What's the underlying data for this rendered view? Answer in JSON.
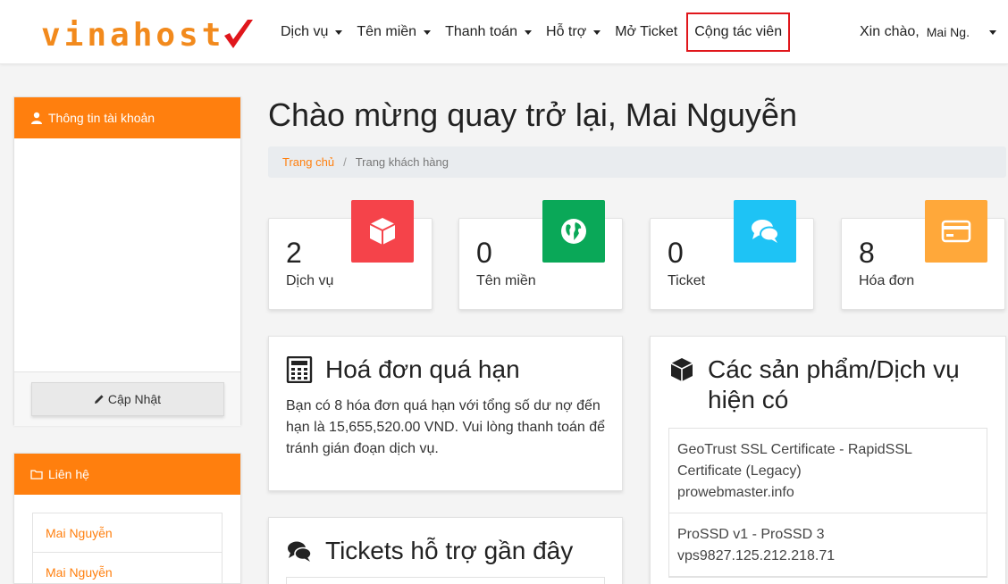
{
  "brand": {
    "name": "vinahost",
    "colors": {
      "primary": "#ff7f0e",
      "logo": "#f28a1d",
      "check": "#e0161b"
    }
  },
  "nav": {
    "items": [
      {
        "label": "Dịch vụ",
        "dropdown": true
      },
      {
        "label": "Tên miền",
        "dropdown": true
      },
      {
        "label": "Thanh toán",
        "dropdown": true
      },
      {
        "label": "Hỗ trợ",
        "dropdown": true
      },
      {
        "label": "Mở Ticket",
        "dropdown": false
      },
      {
        "label": "Cộng tác viên",
        "dropdown": false,
        "highlighted": true
      }
    ],
    "greeting": "Xin chào,",
    "user_short": "Mai Ng."
  },
  "sidebar": {
    "account": {
      "title": "Thông tin tài khoản",
      "icon": "user-icon",
      "update_label": "Cập Nhật"
    },
    "contact": {
      "title": "Liên hệ",
      "icon": "folder-icon",
      "items": [
        "Mai Nguyễn",
        "Mai Nguyễn"
      ]
    }
  },
  "main": {
    "title": "Chào mừng quay trở lại, Mai Nguyễn",
    "breadcrumb": {
      "home": "Trang chủ",
      "separator": "/",
      "current": "Trang khách hàng"
    },
    "stats": [
      {
        "value": "2",
        "label": "Dịch vụ",
        "icon": "cube-icon",
        "color": "#f5434a"
      },
      {
        "value": "0",
        "label": "Tên miền",
        "icon": "globe-icon",
        "color": "#0aa858"
      },
      {
        "value": "0",
        "label": "Ticket",
        "icon": "chat-icon",
        "color": "#1ec3f5"
      },
      {
        "value": "8",
        "label": "Hóa đơn",
        "icon": "credit-card-icon",
        "color": "#ffa83a"
      }
    ],
    "overdue": {
      "title": "Hoá đơn quá hạn",
      "icon": "calculator-icon",
      "text": "Bạn có 8 hóa đơn quá hạn với tổng số dư nợ đến hạn là 15,655,520.00 VND. Vui lòng thanh toán để tránh gián đoạn dịch vụ."
    },
    "products": {
      "title": "Các sản phẩm/Dịch vụ hiện có",
      "icon": "cube-icon",
      "items": [
        {
          "name": "GeoTrust SSL Certificate - RapidSSL Certificate (Legacy)",
          "domain": "prowebmaster.info"
        },
        {
          "name": "ProSSD v1 - ProSSD 3",
          "domain": "vps9827.125.212.218.71"
        }
      ]
    },
    "tickets": {
      "title": "Tickets hỗ trợ gần đây",
      "icon": "comments-icon"
    }
  }
}
